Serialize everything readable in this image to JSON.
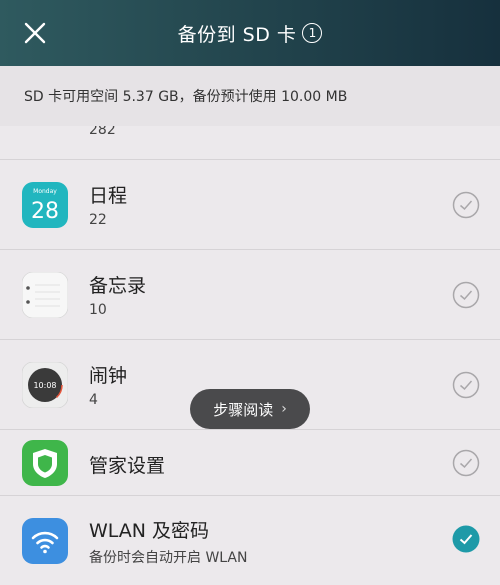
{
  "header": {
    "title": "备份到 SD 卡",
    "count": "1",
    "close_icon": "close-icon"
  },
  "info": {
    "text": "SD 卡可用空间 5.37 GB，备份预计使用 10.00 MB"
  },
  "items": [
    {
      "icon": "app-icon-green",
      "name": "",
      "sub": "282",
      "checked": false
    },
    {
      "icon": "calendar-icon",
      "icon_label_top": "Monday",
      "icon_label_day": "28",
      "name": "日程",
      "sub": "22",
      "checked": false
    },
    {
      "icon": "notepad-icon",
      "name": "备忘录",
      "sub": "10",
      "checked": false
    },
    {
      "icon": "clock-icon",
      "icon_label_time": "10:08",
      "name": "闹钟",
      "sub": "4",
      "checked": false
    },
    {
      "icon": "shield-icon",
      "name": "管家设置",
      "sub": "",
      "checked": false
    },
    {
      "icon": "wifi-icon",
      "name": "WLAN 及密码",
      "sub": "备份时会自动开启 WLAN",
      "checked": true
    }
  ],
  "toast": {
    "label": "步骤阅读",
    "chevron": "›"
  },
  "colors": {
    "header_start": "#2f5a5f",
    "header_end": "#16303d",
    "check_active": "#1e9aa8",
    "background": "#ece9ec"
  }
}
